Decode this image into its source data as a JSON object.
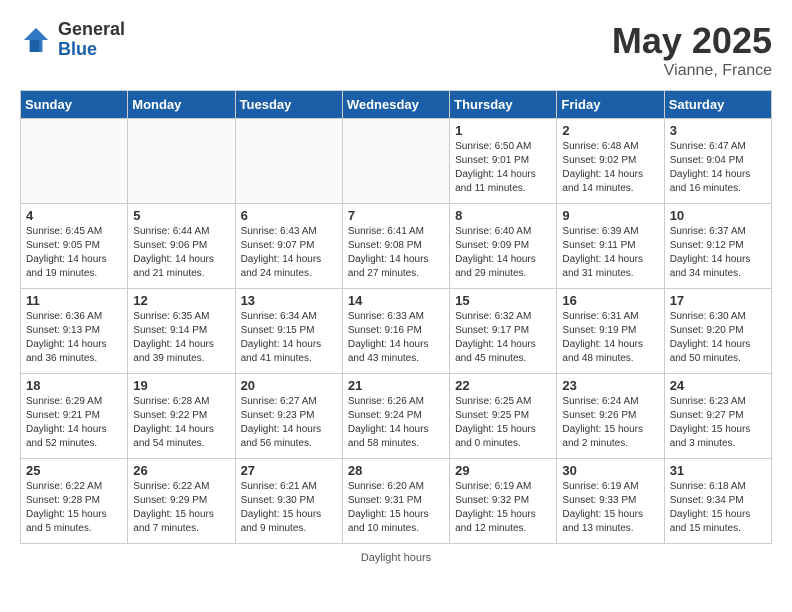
{
  "header": {
    "logo_general": "General",
    "logo_blue": "Blue",
    "month_title": "May 2025",
    "location": "Vianne, France"
  },
  "footer": {
    "text": "Daylight hours",
    "url": "https://www.generalblue.com"
  },
  "days_of_week": [
    "Sunday",
    "Monday",
    "Tuesday",
    "Wednesday",
    "Thursday",
    "Friday",
    "Saturday"
  ],
  "weeks": [
    [
      {
        "day": "",
        "info": ""
      },
      {
        "day": "",
        "info": ""
      },
      {
        "day": "",
        "info": ""
      },
      {
        "day": "",
        "info": ""
      },
      {
        "day": "1",
        "info": "Sunrise: 6:50 AM\nSunset: 9:01 PM\nDaylight: 14 hours\nand 11 minutes."
      },
      {
        "day": "2",
        "info": "Sunrise: 6:48 AM\nSunset: 9:02 PM\nDaylight: 14 hours\nand 14 minutes."
      },
      {
        "day": "3",
        "info": "Sunrise: 6:47 AM\nSunset: 9:04 PM\nDaylight: 14 hours\nand 16 minutes."
      }
    ],
    [
      {
        "day": "4",
        "info": "Sunrise: 6:45 AM\nSunset: 9:05 PM\nDaylight: 14 hours\nand 19 minutes."
      },
      {
        "day": "5",
        "info": "Sunrise: 6:44 AM\nSunset: 9:06 PM\nDaylight: 14 hours\nand 21 minutes."
      },
      {
        "day": "6",
        "info": "Sunrise: 6:43 AM\nSunset: 9:07 PM\nDaylight: 14 hours\nand 24 minutes."
      },
      {
        "day": "7",
        "info": "Sunrise: 6:41 AM\nSunset: 9:08 PM\nDaylight: 14 hours\nand 27 minutes."
      },
      {
        "day": "8",
        "info": "Sunrise: 6:40 AM\nSunset: 9:09 PM\nDaylight: 14 hours\nand 29 minutes."
      },
      {
        "day": "9",
        "info": "Sunrise: 6:39 AM\nSunset: 9:11 PM\nDaylight: 14 hours\nand 31 minutes."
      },
      {
        "day": "10",
        "info": "Sunrise: 6:37 AM\nSunset: 9:12 PM\nDaylight: 14 hours\nand 34 minutes."
      }
    ],
    [
      {
        "day": "11",
        "info": "Sunrise: 6:36 AM\nSunset: 9:13 PM\nDaylight: 14 hours\nand 36 minutes."
      },
      {
        "day": "12",
        "info": "Sunrise: 6:35 AM\nSunset: 9:14 PM\nDaylight: 14 hours\nand 39 minutes."
      },
      {
        "day": "13",
        "info": "Sunrise: 6:34 AM\nSunset: 9:15 PM\nDaylight: 14 hours\nand 41 minutes."
      },
      {
        "day": "14",
        "info": "Sunrise: 6:33 AM\nSunset: 9:16 PM\nDaylight: 14 hours\nand 43 minutes."
      },
      {
        "day": "15",
        "info": "Sunrise: 6:32 AM\nSunset: 9:17 PM\nDaylight: 14 hours\nand 45 minutes."
      },
      {
        "day": "16",
        "info": "Sunrise: 6:31 AM\nSunset: 9:19 PM\nDaylight: 14 hours\nand 48 minutes."
      },
      {
        "day": "17",
        "info": "Sunrise: 6:30 AM\nSunset: 9:20 PM\nDaylight: 14 hours\nand 50 minutes."
      }
    ],
    [
      {
        "day": "18",
        "info": "Sunrise: 6:29 AM\nSunset: 9:21 PM\nDaylight: 14 hours\nand 52 minutes."
      },
      {
        "day": "19",
        "info": "Sunrise: 6:28 AM\nSunset: 9:22 PM\nDaylight: 14 hours\nand 54 minutes."
      },
      {
        "day": "20",
        "info": "Sunrise: 6:27 AM\nSunset: 9:23 PM\nDaylight: 14 hours\nand 56 minutes."
      },
      {
        "day": "21",
        "info": "Sunrise: 6:26 AM\nSunset: 9:24 PM\nDaylight: 14 hours\nand 58 minutes."
      },
      {
        "day": "22",
        "info": "Sunrise: 6:25 AM\nSunset: 9:25 PM\nDaylight: 15 hours\nand 0 minutes."
      },
      {
        "day": "23",
        "info": "Sunrise: 6:24 AM\nSunset: 9:26 PM\nDaylight: 15 hours\nand 2 minutes."
      },
      {
        "day": "24",
        "info": "Sunrise: 6:23 AM\nSunset: 9:27 PM\nDaylight: 15 hours\nand 3 minutes."
      }
    ],
    [
      {
        "day": "25",
        "info": "Sunrise: 6:22 AM\nSunset: 9:28 PM\nDaylight: 15 hours\nand 5 minutes."
      },
      {
        "day": "26",
        "info": "Sunrise: 6:22 AM\nSunset: 9:29 PM\nDaylight: 15 hours\nand 7 minutes."
      },
      {
        "day": "27",
        "info": "Sunrise: 6:21 AM\nSunset: 9:30 PM\nDaylight: 15 hours\nand 9 minutes."
      },
      {
        "day": "28",
        "info": "Sunrise: 6:20 AM\nSunset: 9:31 PM\nDaylight: 15 hours\nand 10 minutes."
      },
      {
        "day": "29",
        "info": "Sunrise: 6:19 AM\nSunset: 9:32 PM\nDaylight: 15 hours\nand 12 minutes."
      },
      {
        "day": "30",
        "info": "Sunrise: 6:19 AM\nSunset: 9:33 PM\nDaylight: 15 hours\nand 13 minutes."
      },
      {
        "day": "31",
        "info": "Sunrise: 6:18 AM\nSunset: 9:34 PM\nDaylight: 15 hours\nand 15 minutes."
      }
    ]
  ]
}
